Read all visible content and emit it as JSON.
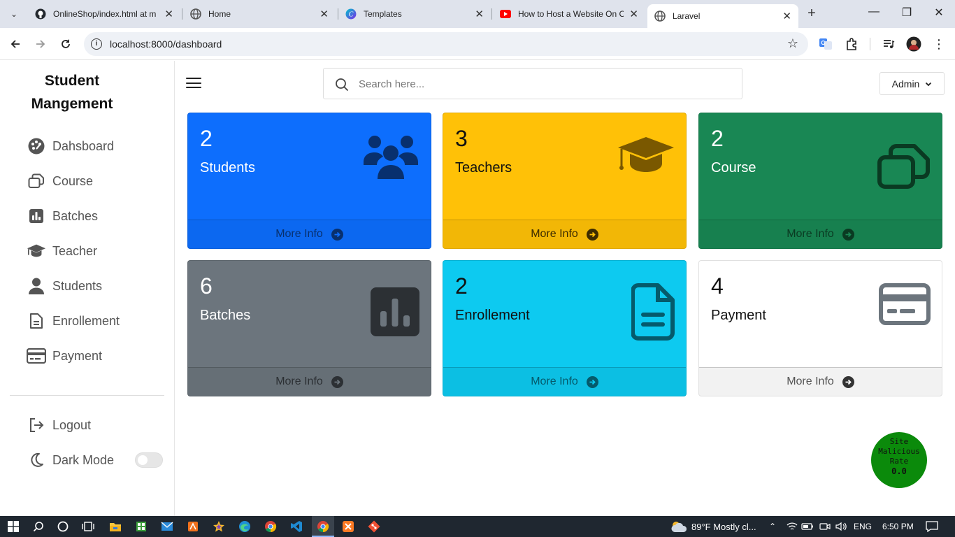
{
  "browser": {
    "tabs": [
      {
        "title": "OnlineShop/index.html at m",
        "icon": "github-icon"
      },
      {
        "title": "Home",
        "icon": "globe-icon"
      },
      {
        "title": "Templates",
        "icon": "canva-icon"
      },
      {
        "title": "How to Host a Website On C",
        "icon": "youtube-icon"
      },
      {
        "title": "Laravel",
        "icon": "globe-icon",
        "active": true
      }
    ],
    "url": "localhost:8000/dashboard"
  },
  "sidebar": {
    "brand": "Student Mangement",
    "items": [
      {
        "label": "Dahsboard",
        "icon": "palette-icon"
      },
      {
        "label": "Course",
        "icon": "copy-icon"
      },
      {
        "label": "Batches",
        "icon": "bar-chart-icon"
      },
      {
        "label": "Teacher",
        "icon": "graduation-cap-icon"
      },
      {
        "label": "Students",
        "icon": "user-icon"
      },
      {
        "label": "Enrollement",
        "icon": "file-lines-icon"
      },
      {
        "label": "Payment",
        "icon": "credit-card-icon"
      }
    ],
    "logout": "Logout",
    "dark_mode": "Dark Mode",
    "dark_mode_on": false
  },
  "header": {
    "search_placeholder": "Search here...",
    "admin_label": "Admin"
  },
  "cards": [
    {
      "count": "2",
      "label": "Students",
      "more": "More Info",
      "bg": "#0d6efd",
      "icon": "users-icon"
    },
    {
      "count": "3",
      "label": "Teachers",
      "more": "More Info",
      "bg": "#ffc107",
      "icon": "graduation-cap-icon"
    },
    {
      "count": "2",
      "label": "Course",
      "more": "More Info",
      "bg": "#198754",
      "icon": "copy-icon"
    },
    {
      "count": "6",
      "label": "Batches",
      "more": "More Info",
      "bg": "#6c757d",
      "icon": "bar-chart-icon"
    },
    {
      "count": "2",
      "label": "Enrollement",
      "more": "More Info",
      "bg": "#0dcaf0",
      "icon": "file-lines-icon"
    },
    {
      "count": "4",
      "label": "Payment",
      "more": "More Info",
      "bg": "#ffffff",
      "icon": "credit-card-icon"
    }
  ],
  "badge": {
    "line1": "Site",
    "line2": "Malicious",
    "line3": "Rate",
    "value": "0.0"
  },
  "taskbar": {
    "weather": "89°F  Mostly cl...",
    "lang": "ENG",
    "time": "6:50 PM"
  }
}
